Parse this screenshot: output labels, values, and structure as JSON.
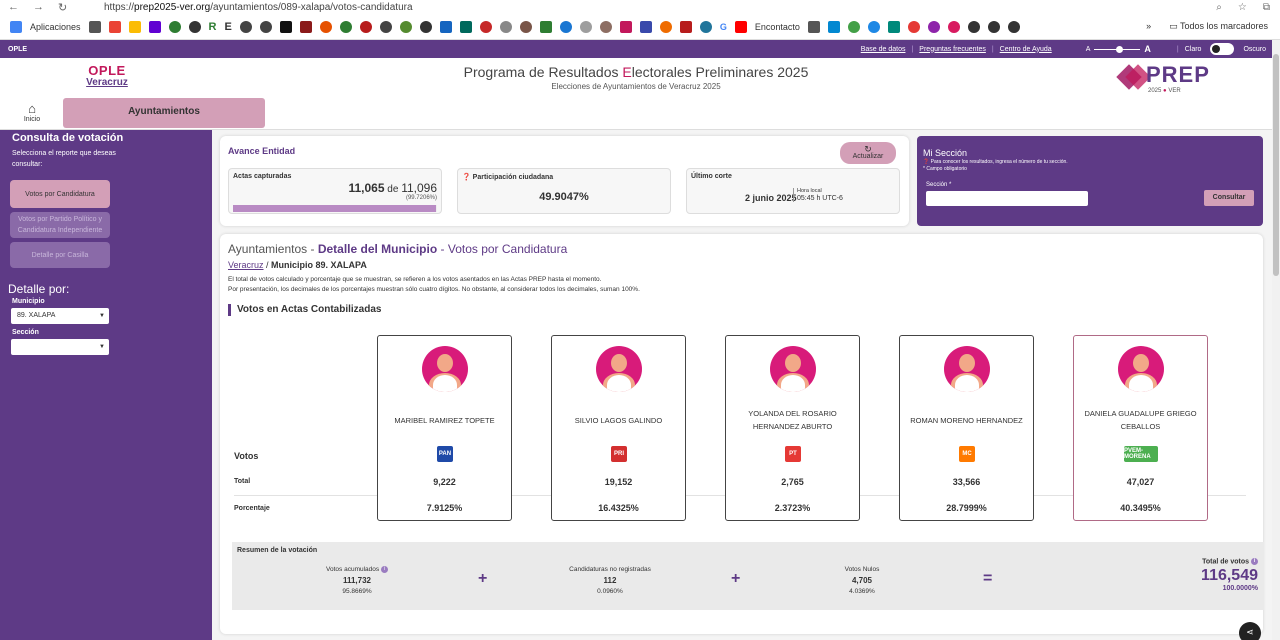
{
  "browser": {
    "url_prefix": "https://",
    "url_host": "prep2025-ver.org",
    "url_path": "/ayuntamientos/089-xalapa/votos-candidatura",
    "bookmarks": [
      "Aplicaciones",
      "R",
      "E",
      "Encontacto",
      "G"
    ],
    "all_bookmarks": "Todos los marcadores"
  },
  "topbar": {
    "links": [
      "Base de datos",
      "Preguntas frecuentes",
      "Centro de Ayuda"
    ],
    "font_small": "A",
    "font_large": "A",
    "theme_light": "Claro",
    "theme_dark": "Oscuro"
  },
  "header": {
    "ople_top": "OPLE",
    "ople_bottom": "Veracruz",
    "title_pre": "Programa de Resultados ",
    "title_e": "E",
    "title_post": "lectorales Preliminares 2025",
    "subtitle": "Elecciones de Ayuntamientos de Veracruz 2025",
    "prep": "PREP",
    "prep_year": "2025",
    "prep_dot": "●",
    "prep_state": "VER"
  },
  "tabs": {
    "home": "Inicio",
    "active": "Ayuntamientos"
  },
  "sidebar": {
    "title": "Consulta de votación",
    "desc": "Selecciona el reporte que deseas consultar:",
    "btn_candidatura": "Votos por Candidatura",
    "btn_partido": "Votos por Partido Político y Candidatura Independiente",
    "btn_casilla": "Detalle por Casilla",
    "detalle": "Detalle por:",
    "municipio_label": "Municipio",
    "municipio_value": "89. XALAPA",
    "seccion_label": "Sección",
    "seccion_value": ""
  },
  "avance": {
    "title": "Avance Entidad",
    "refresh": "Actualizar",
    "actas_label": "Actas capturadas",
    "actas_num": "11,065",
    "actas_de": " de ",
    "actas_total": "11,096",
    "actas_pct": "(99.7206%)",
    "actas_fraction": 0.997206,
    "part_label": "Participación ciudadana",
    "part_value": "49.9047%",
    "corte_label": "Último corte",
    "corte_date": "2 junio 2025",
    "hora_label": "Hora local",
    "hora_value": "05:45 h UTC-6"
  },
  "mi_seccion": {
    "title": "Mi Sección",
    "desc": "Para conocer los resultados, ingresa el número de tu sección.",
    "required": "* Campo obligatorio",
    "field_label": "Sección *",
    "button": "Consultar"
  },
  "detalle": {
    "t1": "Ayuntamientos - ",
    "t2": "Detalle del Municipio",
    "t3": " - Votos por Candidatura",
    "crumb_link": "Veracruz",
    "crumb_sep": " / ",
    "crumb_current": "Municipio 89. XALAPA",
    "note1": "El total de votos calculado y porcentaje que se muestran, se refieren a los votos asentados en las Actas PREP hasta el momento.",
    "note2": "Por presentación, los decimales de los porcentajes muestran sólo cuatro dígitos. No obstante, al considerar todos los decimales, suman 100%.",
    "section": "Votos en Actas Contabilizadas",
    "row_votos": "Votos",
    "row_total": "Total",
    "row_pct": "Porcentaje"
  },
  "candidates": [
    {
      "name": "MARIBEL RAMIREZ TOPETE",
      "party": "PAN",
      "party_color": "#1f4aa8",
      "total": "9,222",
      "pct": "7.9125%"
    },
    {
      "name": "SILVIO LAGOS GALINDO",
      "party": "PRI",
      "party_color": "#d32f2f",
      "total": "19,152",
      "pct": "16.4325%"
    },
    {
      "name": "YOLANDA DEL ROSARIO HERNANDEZ ABURTO",
      "party": "PT",
      "party_color": "#e53935",
      "total": "2,765",
      "pct": "2.3723%"
    },
    {
      "name": "ROMAN MORENO HERNANDEZ",
      "party": "MC",
      "party_color": "#ff7a00",
      "total": "33,566",
      "pct": "28.7999%"
    },
    {
      "name": "DANIELA GUADALUPE GRIEGO CEBALLOS",
      "party": "PVEM-MORENA",
      "party_color": "#4caf50",
      "total": "47,027",
      "pct": "40.3495%"
    }
  ],
  "resumen": {
    "title": "Resumen de la votación",
    "acum_label": "Votos acumulados",
    "acum_value": "111,732",
    "acum_pct": "95.8669%",
    "noreg_label": "Candidaturas no registradas",
    "noreg_value": "112",
    "noreg_pct": "0.0960%",
    "nulos_label": "Votos Nulos",
    "nulos_value": "4,705",
    "nulos_pct": "4.0369%",
    "plus": "+",
    "equals": "=",
    "total_label": "Total de votos",
    "total_value": "116,549",
    "total_pct": "100.0000%"
  }
}
